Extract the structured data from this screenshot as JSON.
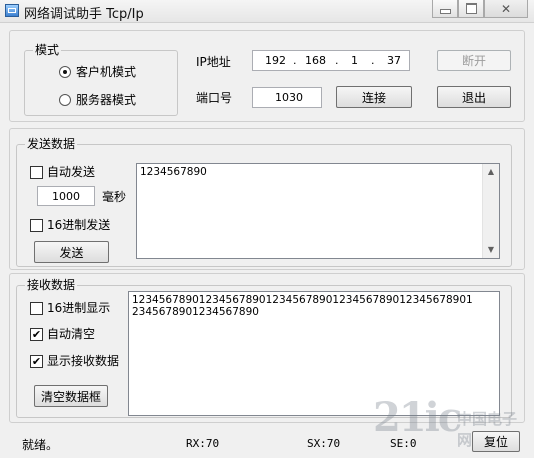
{
  "window": {
    "title": "网络调试助手 Tcp/Ip"
  },
  "mode": {
    "legend": "模式",
    "client_label": "客户机模式",
    "server_label": "服务器模式",
    "selected": "client"
  },
  "connection": {
    "ip_label": "IP地址",
    "ip": [
      "192",
      "168",
      "1",
      "37"
    ],
    "port_label": "端口号",
    "port": "1030",
    "disconnect_label": "断开",
    "connect_label": "连接",
    "exit_label": "退出"
  },
  "send": {
    "legend": "发送数据",
    "auto_send_label": "自动发送",
    "auto_send_checked": false,
    "interval": "1000",
    "ms_label": "毫秒",
    "hex_send_label": "16进制发送",
    "hex_send_checked": false,
    "send_button": "发送",
    "content": "1234567890"
  },
  "receive": {
    "legend": "接收数据",
    "hex_display_label": "16进制显示",
    "hex_display_checked": false,
    "auto_clear_label": "自动清空",
    "auto_clear_checked": true,
    "show_received_label": "显示接收数据",
    "show_received_checked": true,
    "clear_button": "清空数据框",
    "content": "1234567890123456789012345678901234567890123456789012345678901234567890"
  },
  "status": {
    "text": "就绪。",
    "rx": "RX:70",
    "sx": "SX:70",
    "se": "SE:0",
    "reset_label": "复位"
  },
  "watermark": {
    "brand": "21ic",
    "site": "中国电子网"
  }
}
